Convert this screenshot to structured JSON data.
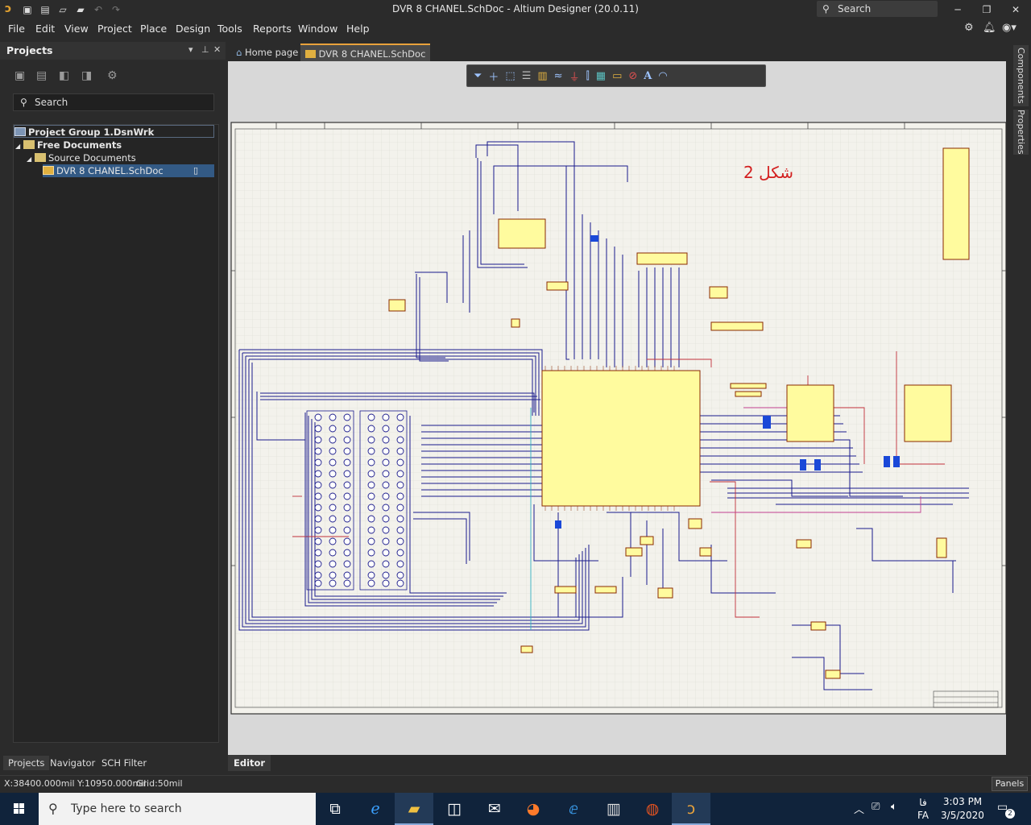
{
  "window": {
    "title": "DVR 8 CHANEL.SchDoc - Altium Designer (20.0.11)",
    "search_placeholder": "Search"
  },
  "menu": [
    "File",
    "Edit",
    "View",
    "Project",
    "Place",
    "Design",
    "Tools",
    "Reports",
    "Window",
    "Help"
  ],
  "projects_panel": {
    "title": "Projects",
    "search_placeholder": "Search",
    "tree": [
      {
        "label": "Project Group 1.DsnWrk",
        "level": 0,
        "icon": "workspace-icon"
      },
      {
        "label": "Free Documents",
        "level": 1,
        "icon": "folder-icon"
      },
      {
        "label": "Source Documents",
        "level": 2,
        "icon": "folder-icon"
      },
      {
        "label": "DVR 8 CHANEL.SchDoc",
        "level": 3,
        "icon": "schematic-doc-icon",
        "selected": true
      }
    ],
    "bottom_tabs": [
      "Projects",
      "Navigator",
      "SCH Filter"
    ]
  },
  "document_tabs": [
    {
      "label": "Home page",
      "icon": "home-icon"
    },
    {
      "label": "DVR 8 CHANEL.SchDoc",
      "icon": "schematic-doc-icon",
      "active": true
    }
  ],
  "editor": {
    "annotation": "شکل 2",
    "annotation_color": "#d32020",
    "bottom_tab": "Editor",
    "toolbar_icons": [
      "filter-icon",
      "cross-icon",
      "select-rect-icon",
      "align-icon",
      "part-icon",
      "wire-icon",
      "power-port-icon",
      "bus-icon",
      "harness-icon",
      "net-label-icon",
      "no-erc-icon",
      "text-icon",
      "arc-icon"
    ]
  },
  "right_rail": [
    "Components",
    "Properties"
  ],
  "status": {
    "coordinates": "X:38400.000mil Y:10950.000mil",
    "grid": "Grid:50mil",
    "panels_button": "Panels"
  },
  "taskbar": {
    "search_placeholder": "Type here to search",
    "language": "FA",
    "language_persian": "فا",
    "time": "3:03 PM",
    "date": "3/5/2020",
    "notification_count": "2"
  },
  "colors": {
    "accent": "#e9a23b",
    "wire": "#1a1a8c",
    "chip_fill": "#fffb9e",
    "sheet_bg": "#f3f2ec"
  }
}
